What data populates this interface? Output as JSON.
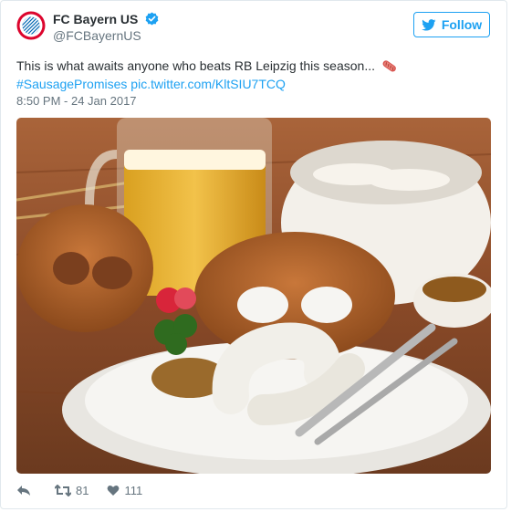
{
  "tweet": {
    "author_name": "FC Bayern US",
    "handle": "@FCBayernUS",
    "follow_label": "Follow",
    "text": "This is what awaits anyone who beats RB Leipzig this season...",
    "hashtag": "#SausagePromises",
    "media_link": "pic.twitter.com/KltSIU7TCQ",
    "timestamp": "8:50 PM - 24 Jan 2017",
    "retweet_count": "81",
    "like_count": "111"
  },
  "colors": {
    "accent": "#1da1f2",
    "text": "#292f33",
    "muted": "#66757f",
    "bayern_red": "#dc052d",
    "bayern_blue": "#0066b2"
  },
  "icons": [
    "bayern-logo-icon",
    "verified-badge-icon",
    "twitter-bird-icon",
    "sausage-emoji-icon",
    "reply-icon",
    "retweet-icon",
    "heart-icon"
  ]
}
